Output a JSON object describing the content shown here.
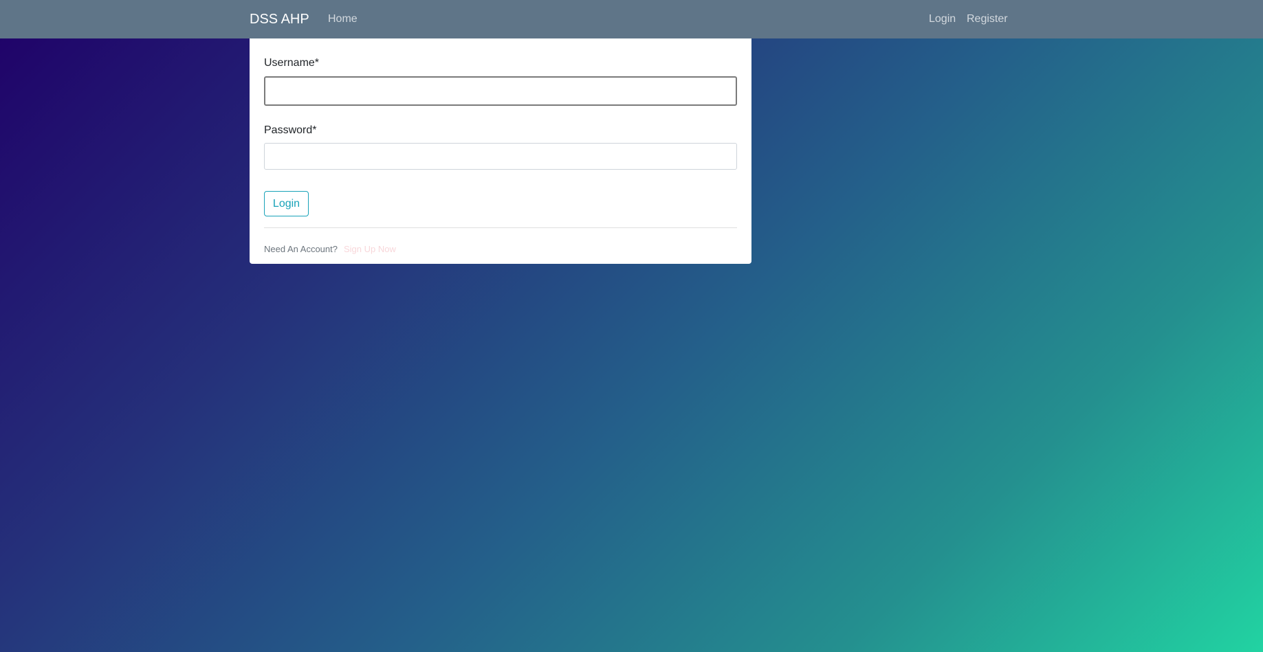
{
  "navbar": {
    "brand": "DSS AHP",
    "home": "Home",
    "login": "Login",
    "register": "Register"
  },
  "form": {
    "username_label": "Username*",
    "username_value": "",
    "password_label": "Password*",
    "password_value": "",
    "submit_label": "Login"
  },
  "footer": {
    "prompt": "Need An Account?",
    "signup_link": "Sign Up Now"
  },
  "colors": {
    "navbar_bg": "#5f7588",
    "button_accent": "#17a2b8",
    "signup_link": "#f8d7da",
    "gradient_start": "#1f0068",
    "gradient_end": "#22d3a2"
  }
}
